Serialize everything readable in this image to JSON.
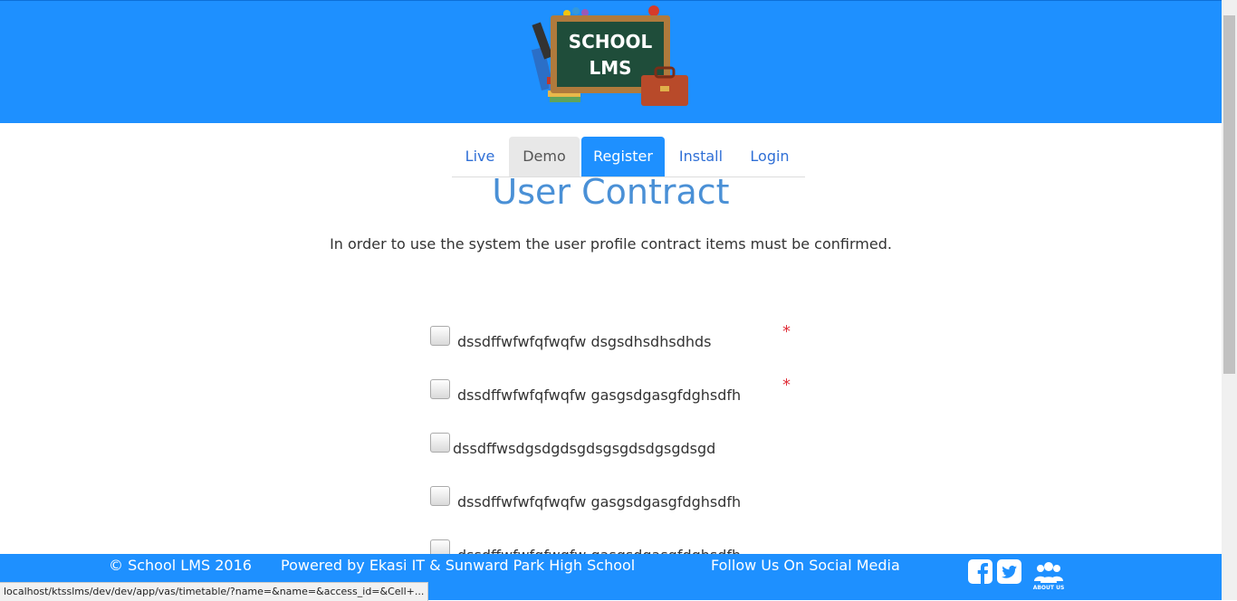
{
  "logo": {
    "line1": "SCHOOL",
    "line2": "LMS"
  },
  "nav": {
    "tabs": [
      {
        "label": "Live"
      },
      {
        "label": "Demo"
      },
      {
        "label": "Register",
        "active": true
      },
      {
        "label": "Install"
      },
      {
        "label": "Login"
      }
    ]
  },
  "page": {
    "title": "User Contract",
    "intro": "In order to use the system the user profile contract items must be confirmed."
  },
  "contract_items": [
    {
      "label": "dssdffwfwfqfwqfw dsgsdhsdhsdhds",
      "required": true,
      "checked": false
    },
    {
      "label": "dssdffwfwfqfwqfw gasgsdgasgfdghsdfh",
      "required": true,
      "checked": false
    },
    {
      "label": "dssdffwsdgsdgdsgdsgsgdsdgsgdsgd",
      "required": false,
      "checked": false
    },
    {
      "label": "dssdffwfwfqfwqfw gasgsdgasgfdghsdfh",
      "required": false,
      "checked": false
    },
    {
      "label": "dssdffwfwfqfwqfw gasgsdgasgfdghsdfh",
      "required": false,
      "checked": false
    }
  ],
  "required_marker": "*",
  "footer": {
    "copyright": "© School LMS 2016",
    "powered_by": "Powered by Ekasi IT & Sunward Park High School",
    "follow": "Follow Us On Social Media",
    "about_label": "ABOUT US"
  },
  "status_bar": {
    "url": "localhost/ktsslms/dev/dev/app/vas/timetable/?name=&name=&access_id=&Cell+..."
  },
  "colors": {
    "brand_blue": "#1e90ff",
    "title_blue": "#4a90d6",
    "required_red": "#e0303a",
    "demo_tab_bg": "#e8e8e8"
  }
}
